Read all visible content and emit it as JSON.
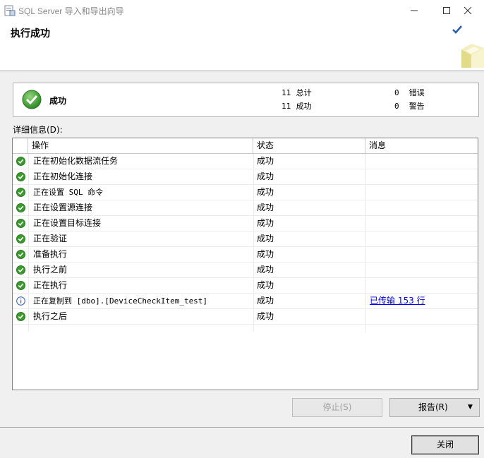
{
  "window": {
    "title": "SQL Server 导入和导出向导"
  },
  "header": {
    "title": "执行成功"
  },
  "summary": {
    "status": "成功",
    "total_count": "11",
    "total_label": "总计",
    "success_count": "11",
    "success_label": "成功",
    "error_count": "0",
    "error_label": "错误",
    "warning_count": "0",
    "warning_label": "警告"
  },
  "details": {
    "label": "详细信息(D):",
    "columns": [
      "操作",
      "状态",
      "消息"
    ],
    "rows": [
      {
        "icon": "success-icon",
        "op": "正在初始化数据流任务",
        "status": "成功",
        "message": ""
      },
      {
        "icon": "success-icon",
        "op": "正在初始化连接",
        "status": "成功",
        "message": ""
      },
      {
        "icon": "success-icon",
        "op": "正在设置 SQL 命令",
        "status": "成功",
        "message": ""
      },
      {
        "icon": "success-icon",
        "op": "正在设置源连接",
        "status": "成功",
        "message": ""
      },
      {
        "icon": "success-icon",
        "op": "正在设置目标连接",
        "status": "成功",
        "message": ""
      },
      {
        "icon": "success-icon",
        "op": "正在验证",
        "status": "成功",
        "message": ""
      },
      {
        "icon": "success-icon",
        "op": "准备执行",
        "status": "成功",
        "message": ""
      },
      {
        "icon": "success-icon",
        "op": "执行之前",
        "status": "成功",
        "message": ""
      },
      {
        "icon": "success-icon",
        "op": "正在执行",
        "status": "成功",
        "message": ""
      },
      {
        "icon": "info-icon",
        "op": "正在复制到 [dbo].[DeviceCheckItem_test]",
        "status": "成功",
        "message": "已传输 153 行"
      },
      {
        "icon": "success-icon",
        "op": "执行之后",
        "status": "成功",
        "message": ""
      }
    ]
  },
  "buttons": {
    "stop": "停止(S)",
    "report": "报告(R)",
    "close": "关闭"
  },
  "colors": {
    "success": "#3a9a2e",
    "info": "#2a5db0",
    "link": "#0000ee"
  }
}
